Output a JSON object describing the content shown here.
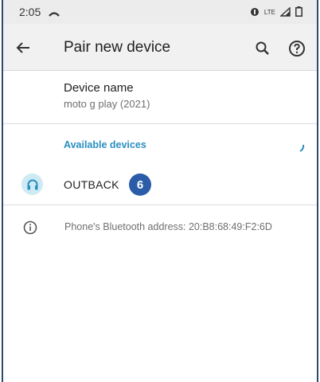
{
  "status_bar": {
    "time": "2:05",
    "network": "LTE"
  },
  "app_bar": {
    "title": "Pair new device",
    "icons": [
      "back-arrow-icon",
      "search-icon",
      "help-icon"
    ]
  },
  "device_name": {
    "label": "Device name",
    "value": "moto g play (2021)"
  },
  "available_section": {
    "header": "Available devices",
    "devices": [
      {
        "name": "OUTBACK",
        "badge": "6",
        "icon": "headphones-icon"
      }
    ]
  },
  "footer_info": {
    "text": "Phone's Bluetooth address: 20:B8:68:49:F2:6D"
  },
  "colors": {
    "accent": "#2a8fc0",
    "badge": "#2a5ca8",
    "appbar": "#f1f1f1",
    "statusbar": "#ececec"
  }
}
